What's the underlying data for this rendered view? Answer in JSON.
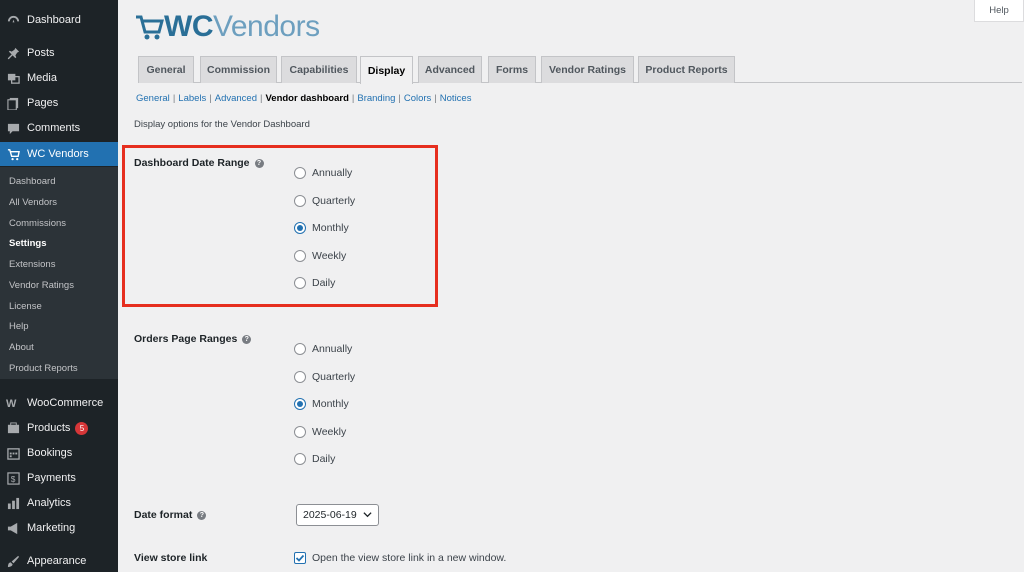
{
  "sidebar": {
    "top": [
      {
        "label": "Dashboard",
        "icon": "dashboard-icon"
      },
      {
        "label": "Posts",
        "icon": "pin-icon"
      },
      {
        "label": "Media",
        "icon": "media-icon"
      },
      {
        "label": "Pages",
        "icon": "pages-icon"
      },
      {
        "label": "Comments",
        "icon": "comment-icon"
      },
      {
        "label": "WC Vendors",
        "icon": "cart-icon"
      }
    ],
    "submenu": [
      "Dashboard",
      "All Vendors",
      "Commissions",
      "Settings",
      "Extensions",
      "Vendor Ratings",
      "License",
      "Help",
      "About",
      "Product Reports"
    ],
    "bottom": [
      {
        "label": "WooCommerce",
        "icon": "woo-icon"
      },
      {
        "label": "Products",
        "icon": "products-icon",
        "badge": "5"
      },
      {
        "label": "Bookings",
        "icon": "calendar-icon"
      },
      {
        "label": "Payments",
        "icon": "dollar-icon"
      },
      {
        "label": "Analytics",
        "icon": "analytics-icon"
      },
      {
        "label": "Marketing",
        "icon": "megaphone-icon"
      },
      {
        "label": "Appearance",
        "icon": "paintbrush-icon"
      }
    ]
  },
  "header": {
    "help_label": "Help",
    "logo_prefix": "WC",
    "logo_suffix": "Vendors"
  },
  "tabs": [
    "General",
    "Commission",
    "Capabilities",
    "Display",
    "Advanced",
    "Forms",
    "Vendor Ratings",
    "Product Reports"
  ],
  "subnav": [
    "General",
    "Labels",
    "Advanced",
    "Vendor dashboard",
    "Branding",
    "Colors",
    "Notices"
  ],
  "description": "Display options for the Vendor Dashboard",
  "dashboard_range": {
    "label": "Dashboard Date Range",
    "options": [
      "Annually",
      "Quarterly",
      "Monthly",
      "Weekly",
      "Daily"
    ],
    "selected": "Monthly"
  },
  "orders_range": {
    "label": "Orders Page Ranges",
    "options": [
      "Annually",
      "Quarterly",
      "Monthly",
      "Weekly",
      "Daily"
    ],
    "selected": "Monthly"
  },
  "date_format": {
    "label": "Date format",
    "value": "2025-06-19"
  },
  "view_store": {
    "label": "View store link",
    "checkbox_label": "Open the view store link in a new window.",
    "checked": true
  },
  "colors": {
    "accent": "#2271b1",
    "highlight": "#e62e1f",
    "sidebar": "#1d2327"
  }
}
